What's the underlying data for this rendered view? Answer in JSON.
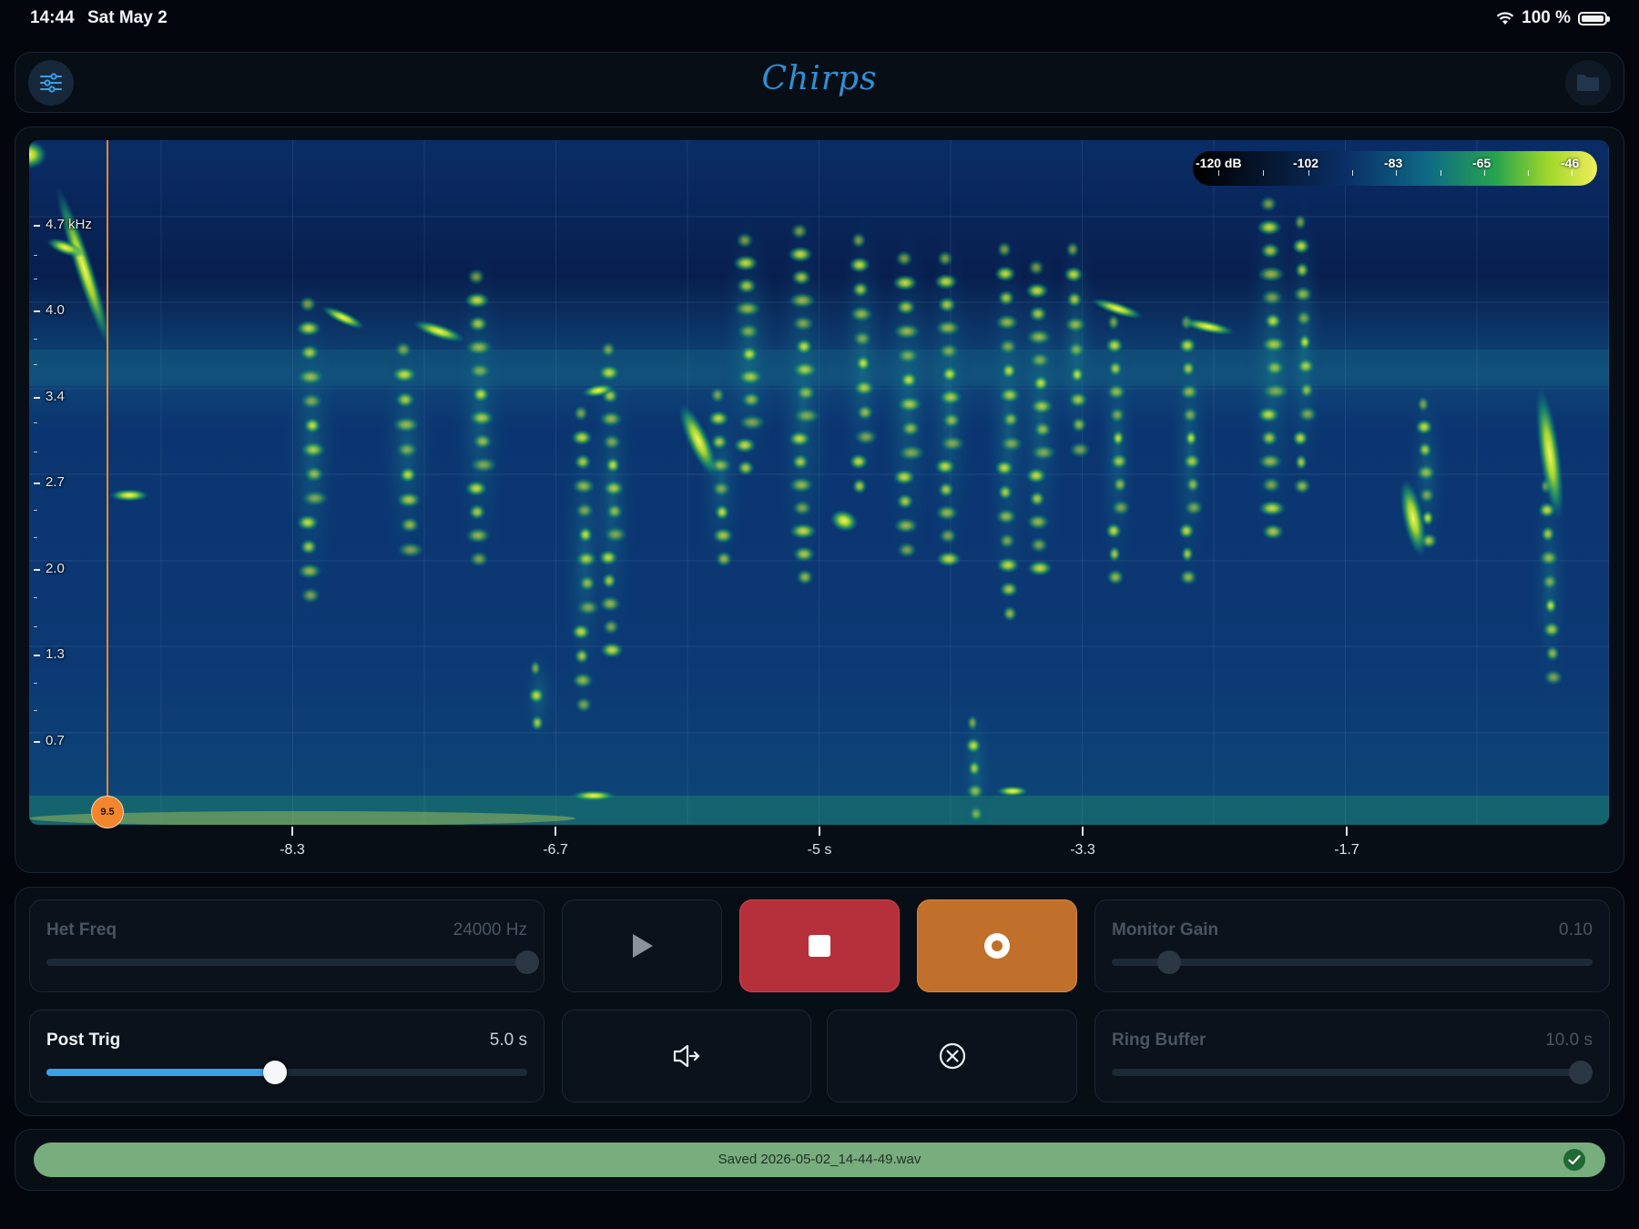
{
  "status_bar": {
    "time": "14:44",
    "date": "Sat May 2",
    "battery": "100 %"
  },
  "header": {
    "title": "Chirps"
  },
  "colorbar": {
    "labels": [
      "-120 dB",
      "-102",
      "-83",
      "-65",
      "-46"
    ]
  },
  "spectrogram": {
    "y_labels": [
      "4.7 kHz",
      "4.0",
      "3.4",
      "2.7",
      "2.0",
      "1.3",
      "0.7"
    ],
    "x_labels": [
      "-8.3",
      "-6.7",
      "-5 s",
      "-3.3",
      "-1.7"
    ],
    "cursor_value": "9.5"
  },
  "controls": {
    "het_freq": {
      "label": "Het Freq",
      "value": "24000 Hz",
      "level": 1.0
    },
    "post_trig": {
      "label": "Post Trig",
      "value": "5.0 s",
      "level": 0.475
    },
    "monitor_gain": {
      "label": "Monitor Gain",
      "value": "0.10",
      "level": 0.12
    },
    "ring_buffer": {
      "label": "Ring Buffer",
      "value": "10.0 s",
      "level": 0.975
    }
  },
  "save_status": {
    "text": "Saved 2026-05-02_14-44-49.wav"
  },
  "colors": {
    "accent": "#3aa0e8",
    "stop": "#b5303a",
    "record": "#c0702a",
    "cursor": "#f08a2c",
    "saved": "#78ad7e"
  }
}
